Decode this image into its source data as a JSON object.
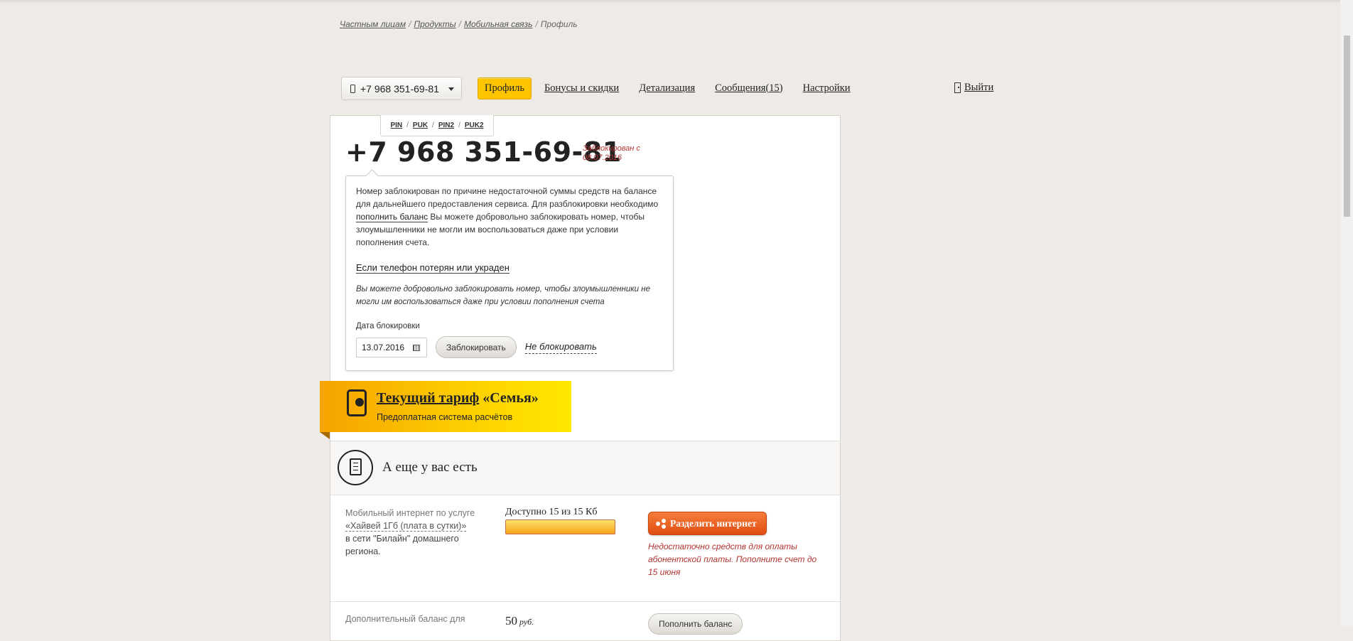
{
  "breadcrumb": [
    "Частным лицам",
    "Продукты",
    "Мобильная связь",
    "Профиль"
  ],
  "phone_select": {
    "value": "+7 968 351-69-81"
  },
  "nav": {
    "tabs": [
      "Профиль",
      "Бонусы и скидки",
      "Детализация",
      "Сообщения(15)",
      "Настройки"
    ],
    "active": "Профиль",
    "logout": "Выйти"
  },
  "codes": [
    "PIN",
    "PUK",
    "PIN2",
    "PUK2"
  ],
  "number": "+7 968 351-69-81",
  "blocked_note": "Заблокирован с 08.07.2016",
  "popup": {
    "text_1": "Номер заблокирован по причине недостаточной суммы средств на балансе для дальнейшего предоставления сервиса. Для разблокировки необходимо ",
    "link": "пополнить баланс",
    "text_2": " Вы можете добровольно заблокировать номер, чтобы злоумышленники не могли им воспользоваться даже при условии пополнения счета.",
    "lost_link": "Если телефон потерян или украден",
    "italic": "Вы можете добровольно заблокировать номер, чтобы злоумышленники не могли им воспользоваться даже при условии пополнения счета",
    "date_label": "Дата блокировки",
    "date_value": "13.07.2016",
    "block_button": "Заблокировать",
    "no_block": "Не блокировать"
  },
  "tariff": {
    "link": "Текущий тариф",
    "name": "«Семья»",
    "sub": "Предоплатная система расчётов"
  },
  "extra": {
    "title": "А еще у вас есть"
  },
  "service": {
    "prefix": "Мобильный интернет по услуге",
    "link": "«Хайвей 1Гб (плата в сутки)»",
    "suffix": "в сети \"Билайн\" домашнего региона.",
    "available": "Доступно 15 из 15 Кб",
    "available_fraction": 1.0,
    "share_button": "Разделить интернет",
    "warning": "Недостаточно средств для оплаты абонентской платы. Пополните счет до 15 июня"
  },
  "balance": {
    "label": "Дополнительный баланс для",
    "value": "50",
    "unit": "руб.",
    "button": "Пополнить баланс"
  }
}
